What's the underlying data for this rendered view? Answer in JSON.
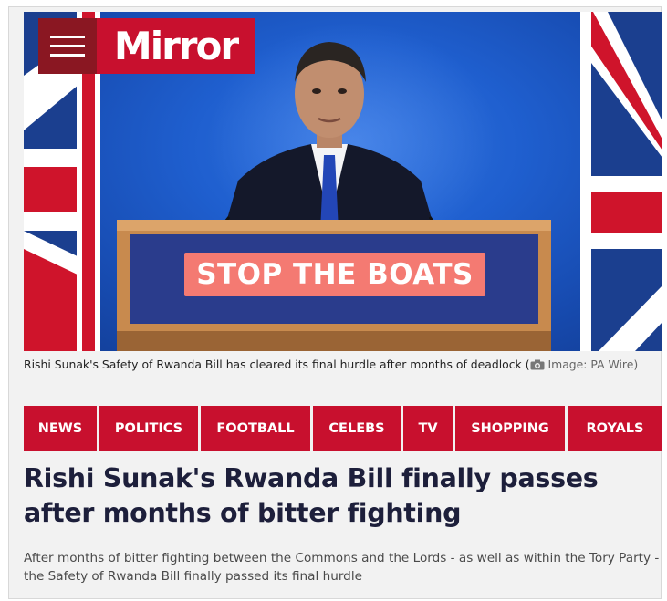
{
  "brand": {
    "name": "Mirror",
    "color": "#c8102e",
    "menu_bg": "#8a1722",
    "menu_icon": "hamburger-menu-icon"
  },
  "hero": {
    "sign_text": "STOP THE BOATS"
  },
  "caption": {
    "text": "Rishi Sunak's Safety of Rwanda Bill has cleared its final hurdle after months of deadlock",
    "open_paren": "(",
    "camera_icon": "camera-icon",
    "credit": "Image: PA Wire)"
  },
  "nav": {
    "items": [
      "NEWS",
      "POLITICS",
      "FOOTBALL",
      "CELEBS",
      "TV",
      "SHOPPING",
      "ROYALS"
    ]
  },
  "article": {
    "headline": "Rishi Sunak's Rwanda Bill finally passes after months of bitter fighting",
    "standfirst": "After months of bitter fighting between the Commons and the Lords - as well as within the Tory Party - the Safety of Rwanda Bill finally passed its final hurdle"
  }
}
